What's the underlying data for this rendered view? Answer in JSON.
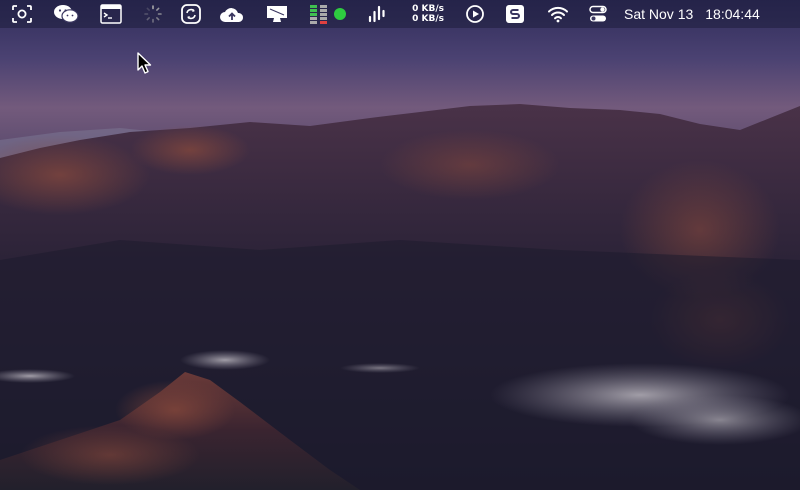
{
  "menubar": {
    "icons": [
      "screenshot-icon",
      "wechat-icon",
      "terminal-icon",
      "loading-spinner-icon",
      "sync-icon",
      "cloud-upload-icon",
      "display-icon",
      "battery-stack-icon",
      "status-dot-icon",
      "audio-levels-icon",
      "play-circle-icon",
      "snagit-icon",
      "wifi-icon",
      "control-center-icon"
    ],
    "net_upload": "0 KB/s",
    "net_download": "0 KB/s",
    "date": "Sat Nov 13",
    "time": "18:04:44",
    "status_dot_color": "#2ecc40"
  }
}
